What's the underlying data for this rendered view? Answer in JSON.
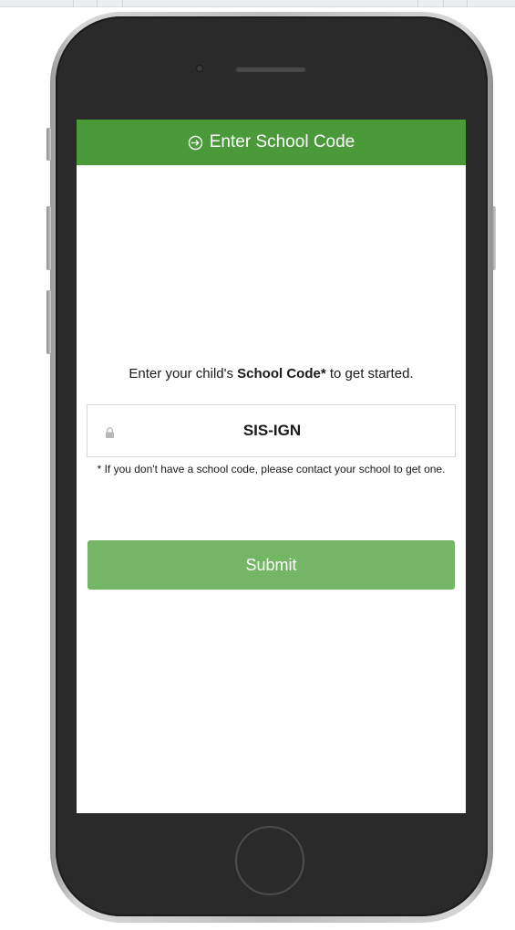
{
  "header": {
    "title": "Enter School Code",
    "icon": "login-icon",
    "color": "#4a9a3a"
  },
  "prompt": {
    "before": "Enter your child's ",
    "emphasis": "School Code*",
    "after": " to get started."
  },
  "code_field": {
    "icon": "lock-icon",
    "value": "SIS-IGN"
  },
  "note": "* If you don't have a school code, please contact your school to get one.",
  "submit": {
    "label": "Submit",
    "color": "#74b566"
  }
}
